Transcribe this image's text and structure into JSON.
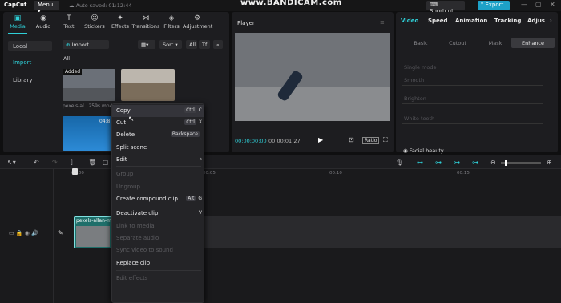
{
  "app": {
    "name": "CapCut",
    "menu_label": "Menu",
    "autosave_text": "Auto saved: 01:12:44",
    "watermark": "www.BANDICAM.com",
    "shortcut_label": "Shortcut",
    "export_label": "Export"
  },
  "toolbar": {
    "items": [
      {
        "label": "Media",
        "icon": "media-icon",
        "glyph": "▣",
        "active": true
      },
      {
        "label": "Audio",
        "icon": "audio-icon",
        "glyph": "◉"
      },
      {
        "label": "Text",
        "icon": "text-icon",
        "glyph": "T"
      },
      {
        "label": "Stickers",
        "icon": "sticker-icon",
        "glyph": "☺"
      },
      {
        "label": "Effects",
        "icon": "effects-icon",
        "glyph": "✦"
      },
      {
        "label": "Transitions",
        "icon": "transition-icon",
        "glyph": "⋈"
      },
      {
        "label": "Filters",
        "icon": "filter-icon",
        "glyph": "◈"
      },
      {
        "label": "Adjustment",
        "icon": "adjust-icon",
        "glyph": "⚙"
      }
    ]
  },
  "media": {
    "sidebar": [
      "Local",
      "Import",
      "Library"
    ],
    "import_label": "Import",
    "sort_label": "Sort",
    "all_label": "All",
    "filter_all": "All",
    "clips": [
      {
        "badge": "Added",
        "name": "pexels-al...259s.mp4"
      },
      {
        "badge": "",
        "name": ""
      },
      {
        "badge": "",
        "name": "04:8"
      }
    ]
  },
  "player": {
    "title": "Player",
    "time_current": "00:00:00:00",
    "time_total": "00:00:01:27",
    "ratio_label": "Ratio"
  },
  "right_panel": {
    "tabs": [
      "Video",
      "Speed",
      "Animation",
      "Tracking",
      "Adjus"
    ],
    "segments": [
      "Basic",
      "Cutout",
      "Mask",
      "Enhance"
    ],
    "props": [
      "Single mode",
      "Smooth",
      "Brighten",
      "White teeth"
    ],
    "section": "Facial beauty"
  },
  "timeline": {
    "ticks": [
      "00:00",
      "00:05",
      "00:10",
      "00:15"
    ],
    "clip_label": "pexels-allan-m"
  },
  "context_menu": {
    "items": [
      {
        "label": "Copy",
        "shortcut": "Ctrl",
        "key": "C",
        "disabled": false,
        "hl": true
      },
      {
        "label": "Cut",
        "shortcut": "Ctrl",
        "key": "X",
        "disabled": false
      },
      {
        "label": "Delete",
        "shortcut": "Backspace",
        "key": "",
        "disabled": false
      },
      {
        "label": "Split scene",
        "shortcut": "",
        "key": "",
        "disabled": false
      },
      {
        "label": "Edit",
        "shortcut": "",
        "key": "›",
        "disabled": false
      },
      {
        "label": "Group",
        "shortcut": "",
        "key": "",
        "disabled": true,
        "sep_before": true
      },
      {
        "label": "Ungroup",
        "shortcut": "",
        "key": "",
        "disabled": true
      },
      {
        "label": "Create compound clip",
        "shortcut": "Alt",
        "key": "G",
        "disabled": false
      },
      {
        "label": "Deactivate clip",
        "shortcut": "",
        "key": "V",
        "disabled": false
      },
      {
        "label": "Link to media",
        "shortcut": "",
        "key": "",
        "disabled": true
      },
      {
        "label": "Separate audio",
        "shortcut": "",
        "key": "",
        "disabled": true
      },
      {
        "label": "Sync video to sound",
        "shortcut": "",
        "key": "",
        "disabled": true
      },
      {
        "label": "Replace clip",
        "shortcut": "",
        "key": "",
        "disabled": false
      },
      {
        "label": "Edit effects",
        "shortcut": "",
        "key": "",
        "disabled": true,
        "sep_before": true
      }
    ]
  },
  "colors": {
    "accent": "#2fd0d8",
    "export": "#1da1c7",
    "clip": "#1f6f6a"
  }
}
